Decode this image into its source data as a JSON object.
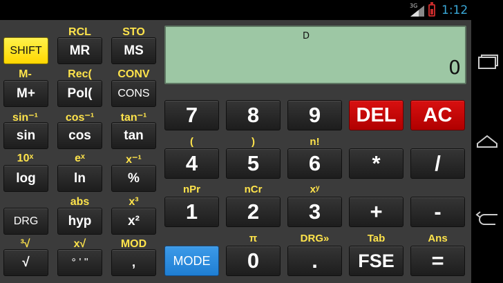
{
  "status_bar": {
    "network": "3G",
    "time": "1:12"
  },
  "navigation": {
    "icons": [
      "recent-apps-icon",
      "home-icon",
      "back-icon"
    ]
  },
  "display": {
    "angle_mode": "D",
    "value": "0"
  },
  "sci_labels": {
    "rcl": "RCL",
    "sto": "STO",
    "m_minus": "M-",
    "rec": "Rec(",
    "conv": "CONV",
    "sin_inv": "sin⁻¹",
    "cos_inv": "cos⁻¹",
    "tan_inv": "tan⁻¹",
    "ten_x": "10ˣ",
    "e_x": "eˣ",
    "x_inv": "x⁻¹",
    "abs": "abs",
    "x_cube": "x³",
    "cube_root": "³√",
    "x_root": "x√",
    "mod": "MOD"
  },
  "sci_keys": {
    "shift": "SHIFT",
    "mr": "MR",
    "ms": "MS",
    "m_plus": "M+",
    "pol": "Pol(",
    "cons": "CONS",
    "sin": "sin",
    "cos": "cos",
    "tan": "tan",
    "log": "log",
    "ln": "ln",
    "percent": "%",
    "drg": "DRG",
    "hyp": "hyp",
    "x_square": "x²",
    "sqrt": "√",
    "deg_min_sec": "° ' \"",
    "comma": ","
  },
  "num_labels": {
    "lparen": "(",
    "rparen": ")",
    "fact": "n!",
    "npr": "nPr",
    "ncr": "nCr",
    "xy": "xʸ",
    "pi": "π",
    "drg_conv": "DRG»",
    "tab": "Tab",
    "ans": "Ans"
  },
  "num_keys": {
    "seven": "7",
    "eight": "8",
    "nine": "9",
    "del": "DEL",
    "ac": "AC",
    "four": "4",
    "five": "5",
    "six": "6",
    "mul": "*",
    "div": "/",
    "one": "1",
    "two": "2",
    "three": "3",
    "plus": "+",
    "minus": "-",
    "mode": "MODE",
    "zero": "0",
    "dot": ".",
    "fse": "FSE",
    "eq": "="
  },
  "colors": {
    "label_yellow": "#ffe44b",
    "display_green": "#9dc7a4",
    "red_key": "#c80000",
    "blue_key": "#2b8be0",
    "shift_yellow": "#fff24a",
    "status_blue": "#3aa9d9"
  }
}
